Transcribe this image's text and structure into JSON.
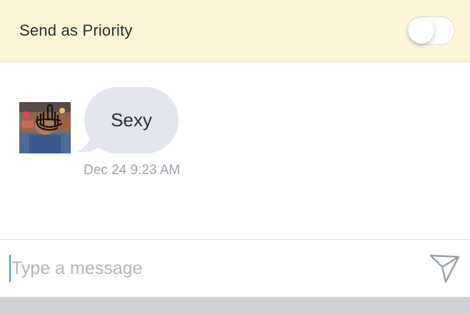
{
  "priority": {
    "label": "Send as Priority",
    "enabled": false
  },
  "conversation": {
    "messages": [
      {
        "text": "Sexy",
        "timestamp": "Dec 24 9:23 AM",
        "avatar": "user-avatar-photo"
      }
    ]
  },
  "composer": {
    "placeholder": "Type a message",
    "value": "",
    "send_icon": "send-icon"
  },
  "colors": {
    "priority_bg": "#fcf5d7",
    "bubble_bg": "#e4e6ee",
    "caret": "#4a90e2",
    "timestamp": "#9ea3ad"
  }
}
